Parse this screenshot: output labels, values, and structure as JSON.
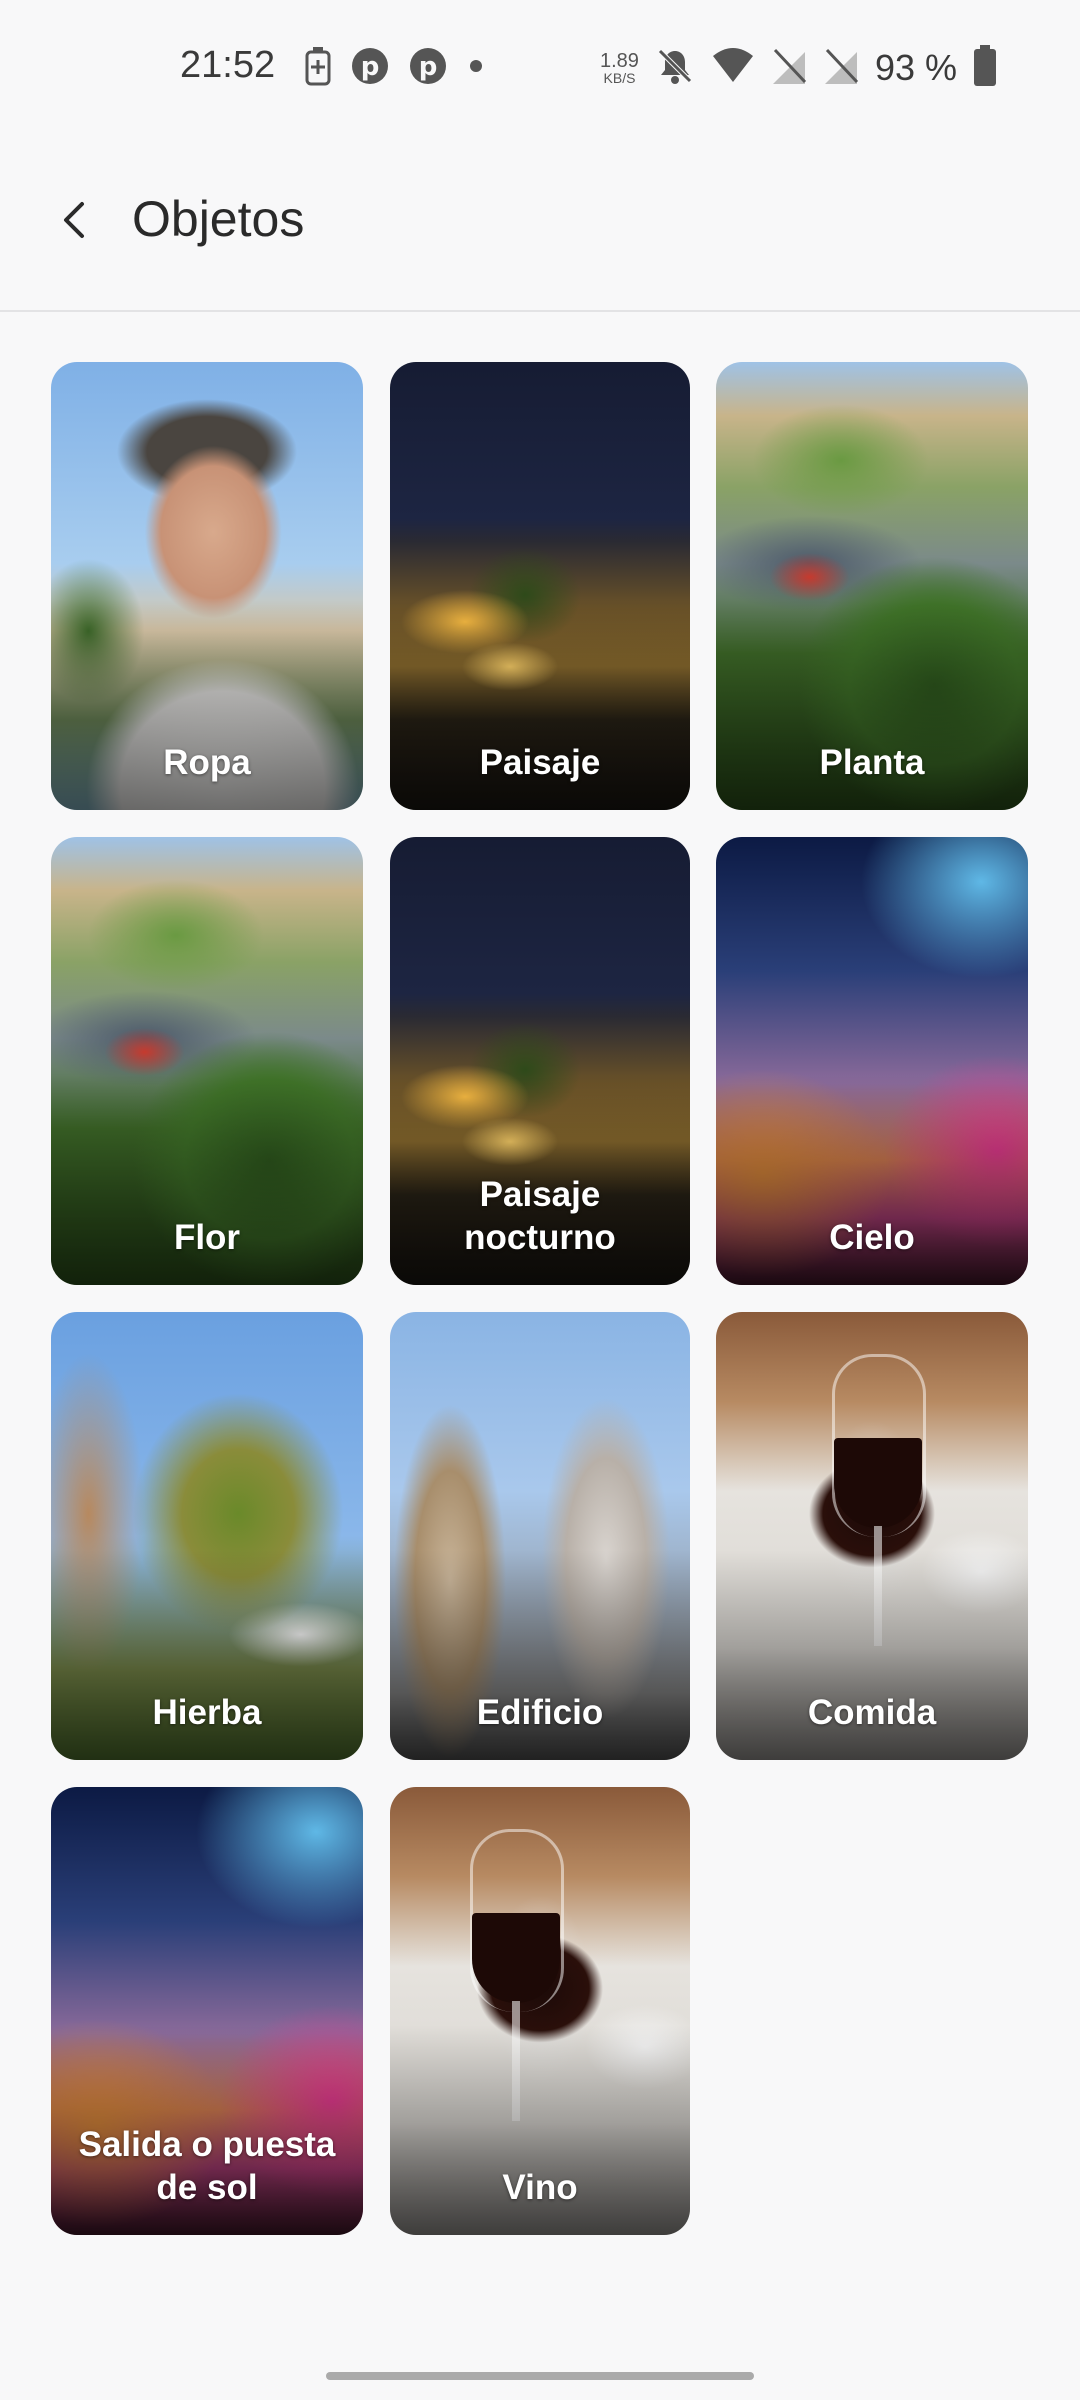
{
  "status_bar": {
    "time": "21:52",
    "net_speed": "1.89",
    "net_unit": "KB/S",
    "battery_pct": "93 %",
    "icons": [
      "battery-saver-icon",
      "pinterest-icon",
      "pinterest-icon",
      "dot-icon",
      "mute-icon",
      "wifi-icon",
      "no-sim-icon",
      "no-sim-icon",
      "battery-icon"
    ]
  },
  "app_bar": {
    "title": "Objetos",
    "back_icon": "back-arrow-icon"
  },
  "tiles": [
    {
      "label": "Ropa"
    },
    {
      "label": "Paisaje"
    },
    {
      "label": "Planta"
    },
    {
      "label": "Flor"
    },
    {
      "label": "Paisaje\nnocturno"
    },
    {
      "label": "Cielo"
    },
    {
      "label": "Hierba"
    },
    {
      "label": "Edificio"
    },
    {
      "label": "Comida"
    },
    {
      "label": "Salida o puesta\nde sol"
    },
    {
      "label": "Vino"
    }
  ]
}
